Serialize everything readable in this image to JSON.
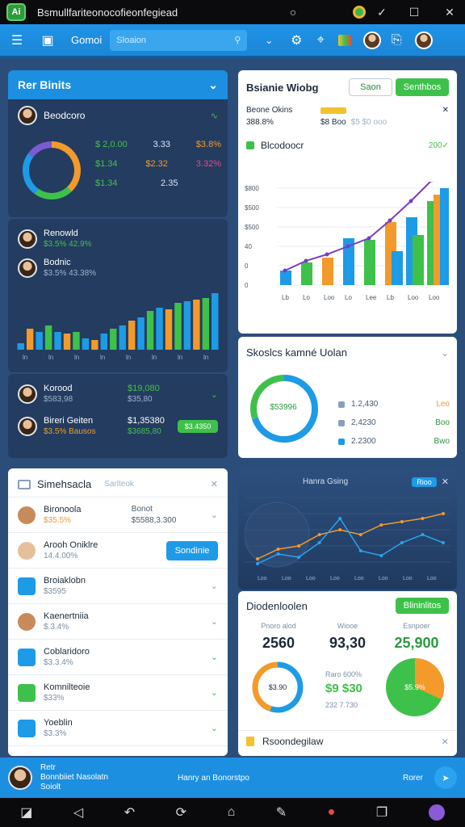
{
  "window": {
    "title": "Bsmullfariteonocofieonfegiead",
    "logo_text": "Ai"
  },
  "toolbar": {
    "brand": "Gomoi",
    "search_placeholder": "Sloaion"
  },
  "panel_left_top": {
    "header": "Rer Binits",
    "user_name": "Beodcoro",
    "stats": [
      {
        "label": "$ 2,0.00",
        "value": "3.33",
        "extra": "$3.8%"
      },
      {
        "label": "$1.34",
        "value": "$2.32",
        "extra": "3.32%"
      },
      {
        "label": "$1.34",
        "value": "2.35",
        "extra": ""
      }
    ],
    "donut": {
      "segments": [
        38,
        22,
        25,
        15
      ],
      "colors": [
        "#f39a2a",
        "#3ec14a",
        "#1d9be6",
        "#7a5bd6"
      ]
    }
  },
  "panel_left_bars": {
    "rows": [
      {
        "name": "Renowld",
        "sub": "$3.5% 42.9%"
      },
      {
        "name": "Bodnic",
        "sub": "$3.5% 43.38%"
      }
    ],
    "bars": [
      8,
      26,
      22,
      30,
      22,
      20,
      22,
      14,
      12,
      20,
      26,
      30,
      36,
      40,
      48,
      52,
      50,
      58,
      60,
      62,
      64,
      70
    ],
    "bar_colors": [
      "#1d9be6",
      "#f39a2a",
      "#1d9be6",
      "#3ec14a",
      "#1d9be6",
      "#f39a2a",
      "#3ec14a",
      "#1d9be6",
      "#f39a2a",
      "#1d9be6",
      "#3ec14a",
      "#1d9be6",
      "#f39a2a",
      "#1d9be6",
      "#3ec14a",
      "#1d9be6",
      "#f39a2a",
      "#3ec14a",
      "#1d9be6",
      "#f39a2a",
      "#3ec14a",
      "#1d9be6"
    ],
    "ticks": [
      "ln",
      "ln",
      "ln",
      "ln",
      "ln",
      "ln",
      "ln",
      "ln"
    ]
  },
  "panel_left_footer": {
    "row1": {
      "name": "Korood",
      "sub": "$583,98",
      "value": "$19,080",
      "sub2": "$35,80"
    },
    "row2": {
      "name": "Bireri Geiten",
      "sub": "$3.5% Bausos",
      "value": "$1,35380",
      "sub2": "$3685,80",
      "button": "$3.4350"
    }
  },
  "panel_right_top": {
    "title": "Bsianie Wiobg",
    "btn_outline": "Saon",
    "btn_green": "Senthbos",
    "row1_label": "Beone Okins",
    "row1_value": "388.8%",
    "row2_label": "$8 Boo",
    "row2_extra": "$5 $0 ooo",
    "section_label": "Blcodoocr",
    "section_value": "200✓",
    "chart": {
      "y_ticks": [
        "$800",
        "$500",
        "$500",
        "40",
        "0",
        "0"
      ],
      "x_ticks": [
        "Lb",
        "Lo",
        "Loo",
        "Lo",
        "Lee",
        "Lb",
        "Loo",
        "Loo"
      ],
      "groups": [
        [
          18,
          0,
          0
        ],
        [
          28,
          0,
          0
        ],
        [
          34,
          0,
          0
        ],
        [
          58,
          0,
          0
        ],
        [
          56,
          0,
          0
        ],
        [
          78,
          42,
          0
        ],
        [
          84,
          62,
          0
        ],
        [
          104,
          112,
          120
        ]
      ],
      "line": [
        18,
        30,
        38,
        48,
        58,
        80,
        104,
        130
      ]
    }
  },
  "panel_right_mid": {
    "title": "Skoslcs kamné Uolan",
    "donut_value": "$53996",
    "items": [
      {
        "value": "1.2,430",
        "tag": "Leo"
      },
      {
        "value": "2,4230",
        "tag": "Boo"
      },
      {
        "value": "2.2300",
        "tag": "Bwo"
      }
    ]
  },
  "panel_left_bottom": {
    "title": "Simehsacla",
    "tab": "Sarlteok",
    "items": [
      {
        "title": "Bironoola",
        "sub": "$35.5%",
        "value": "Bonot",
        "sub2": "$5588,3.300"
      },
      {
        "title": "Arooh Oniklre",
        "sub": "14.4.00%",
        "button": "Sondinie"
      },
      {
        "title": "Broiaklobn",
        "sub": "$3595"
      },
      {
        "title": "Kaenertniia",
        "sub": "$.3.4%"
      },
      {
        "title": "Coblaridoro",
        "sub": "$3.3.4%"
      },
      {
        "title": "Komnilteoie",
        "sub": "$33%"
      },
      {
        "title": "Yoeblin",
        "sub": "$3.3%"
      }
    ]
  },
  "panel_right_map": {
    "title": "Hanra Gsing",
    "tag": "Rioo",
    "series_a": [
      10,
      22,
      26,
      40,
      46,
      40,
      52,
      56,
      60,
      66
    ],
    "series_b": [
      4,
      16,
      12,
      30,
      60,
      20,
      14,
      30,
      40,
      30
    ],
    "x_ticks": [
      "Loo",
      "Loo",
      "Loo",
      "Loo",
      "Loo",
      "Loo",
      "Loo",
      "Loo"
    ]
  },
  "panel_right_bottom": {
    "title": "Diodenloolen",
    "button": "Blininlitos",
    "cols": [
      {
        "label": "Pnoro alod",
        "value": "2560",
        "color": "#1b2a3a"
      },
      {
        "label": "Wiooe",
        "value": "93,30",
        "color": "#1b2a3a"
      },
      {
        "label": "Esnpoer",
        "value": "25,900",
        "color": "#2b9a3e"
      }
    ],
    "donut1_value": "$3.90",
    "donut3_value": "$5.9%",
    "mid_label": "Raro 600%",
    "mid_value": "$9 $30",
    "mid_sub": "232 7.730",
    "footer": "Rsoondegilaw"
  },
  "statusbar": {
    "name": "Retr",
    "sub1": "Bonnbiiet Nasolatn",
    "sub2": "Soiolt",
    "middle": "Hanry an Bonorstpo",
    "right": "Rorer"
  }
}
